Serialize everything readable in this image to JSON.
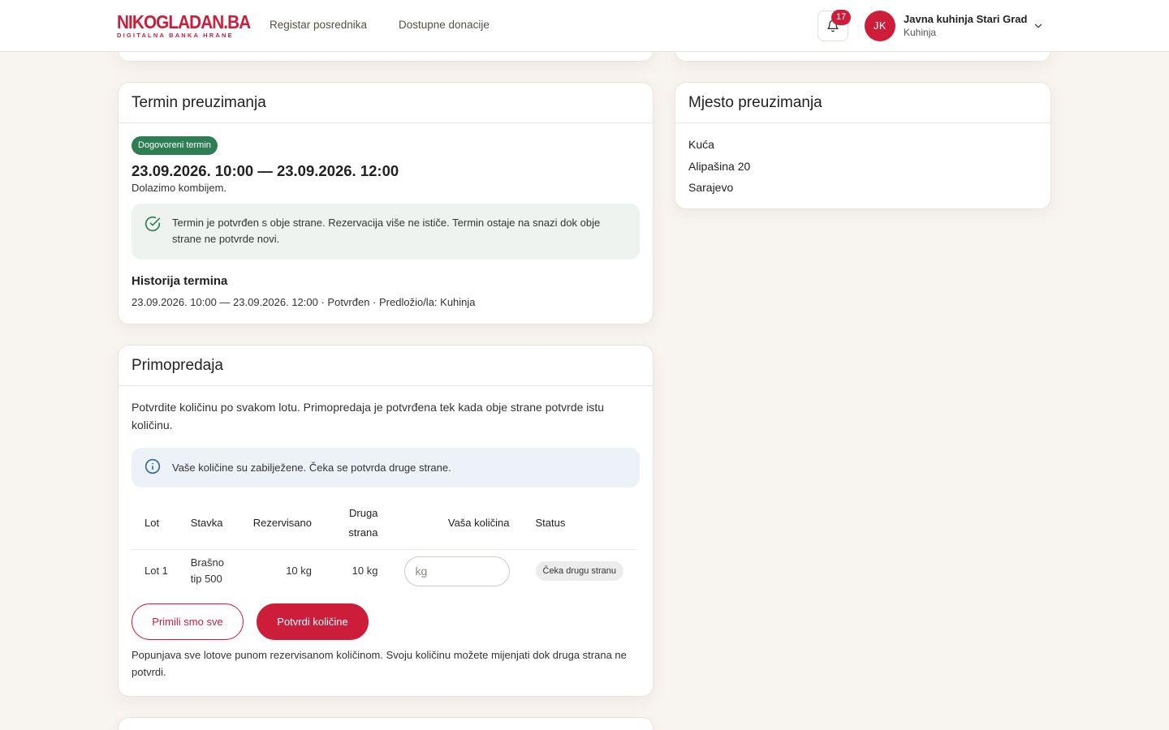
{
  "header": {
    "logo_main": "NIKOGLADAN.BA",
    "logo_sub": "DIGITALNA BANKA HRANE",
    "nav": [
      "Registar posrednika",
      "Dostupne donacije"
    ],
    "notifications_count": "17",
    "user": {
      "initials": "JK",
      "name": "Javna kuhinja Stari Grad",
      "role": "Kuhinja"
    }
  },
  "term": {
    "title": "Termin preuzimanja",
    "badge": "Dogovoreni termin",
    "range": "23.09.2026. 10:00 — 23.09.2026. 12:00",
    "note": "Dolazimo kombijem.",
    "alert": "Termin je potvrđen s obje strane. Rezervacija više ne ističe. Termin ostaje na snazi dok obje strane ne potvrde novi.",
    "history_title": "Historija termina",
    "history_entries": [
      "23.09.2026. 10:00 — 23.09.2026. 12:00 · Potvrđen · Predložio/la: Kuhinja"
    ]
  },
  "location": {
    "title": "Mjesto preuzimanja",
    "lines": [
      "Kuća",
      "Alipašina 20",
      "Sarajevo"
    ]
  },
  "handover": {
    "title": "Primopredaja",
    "intro": "Potvrdite količinu po svakom lotu. Primopredaja je potvrđena tek kada obje strane potvrde istu količinu.",
    "info": "Vaše količine su zabilježene. Čeka se potvrda druge strane.",
    "columns": [
      "Lot",
      "Stavka",
      "Rezervisano",
      "Druga strana",
      "Vaša količina",
      "Status"
    ],
    "rows": [
      {
        "lot": "Lot 1",
        "item": "Brašno tip 500",
        "reserved": "10 kg",
        "other": "10 kg",
        "input_placeholder": "kg",
        "status": "Čeka drugu stranu"
      }
    ],
    "btn_all": "Primili smo sve",
    "btn_confirm": "Potvrdi količine",
    "footnote": "Popunjava sve lotove punom rezervisanom količinom. Svoju količinu možete mijenjati dok druga strana ne potvrdi."
  },
  "colors": {
    "brand": "#cc1e3a",
    "success": "#2f7d55",
    "background": "#f8f4ef"
  },
  "icons": {
    "bell": "bell-icon",
    "chevron": "chevron-down-icon",
    "check": "check-circle-icon",
    "info": "info-icon"
  }
}
